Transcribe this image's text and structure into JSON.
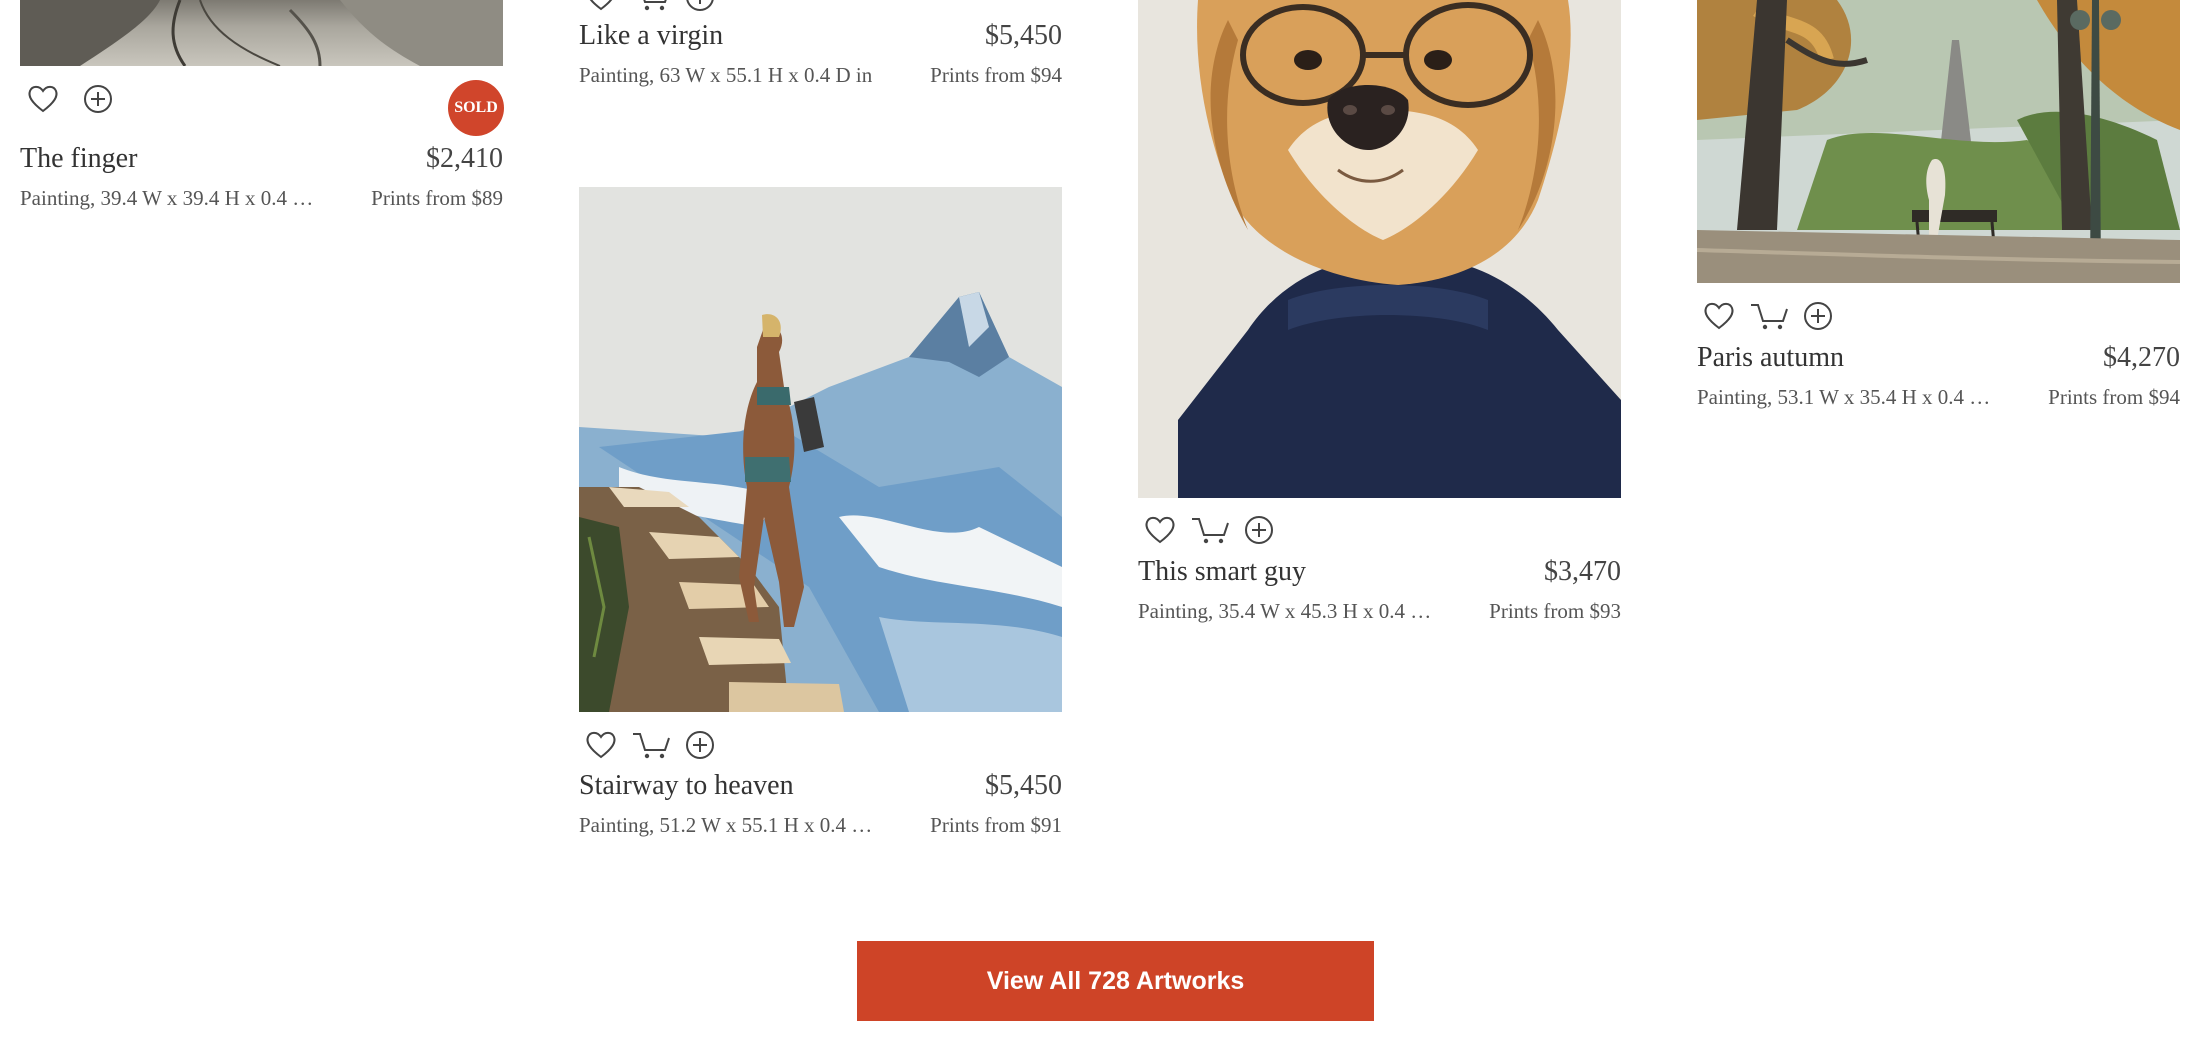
{
  "artworks": [
    {
      "title": "The finger",
      "price": "$2,410",
      "meta": "Painting, 39.4 W x 39.4 H x 0.4 …",
      "prints": "Prints from $89",
      "badge": "SOLD"
    },
    {
      "title": "Like a virgin",
      "price": "$5,450",
      "meta": "Painting, 63 W x 55.1 H x 0.4 D in",
      "prints": "Prints from $94"
    },
    {
      "title": "Stairway to heaven",
      "price": "$5,450",
      "meta": "Painting, 51.2 W x 55.1 H x 0.4 …",
      "prints": "Prints from $91"
    },
    {
      "title": "This smart guy",
      "price": "$3,470",
      "meta": "Painting, 35.4 W x 45.3 H x 0.4 …",
      "prints": "Prints from $93"
    },
    {
      "title": "Paris autumn",
      "price": "$4,270",
      "meta": "Painting, 53.1 W x 35.4 H x 0.4 …",
      "prints": "Prints from $94"
    }
  ],
  "icons": {
    "favorite": "heart-icon",
    "cart": "cart-icon",
    "add": "plus-circle-icon"
  },
  "cta": {
    "label": "View All 728 Artworks"
  },
  "colors": {
    "accent": "#ce4427",
    "sold_badge": "#d0452b"
  }
}
